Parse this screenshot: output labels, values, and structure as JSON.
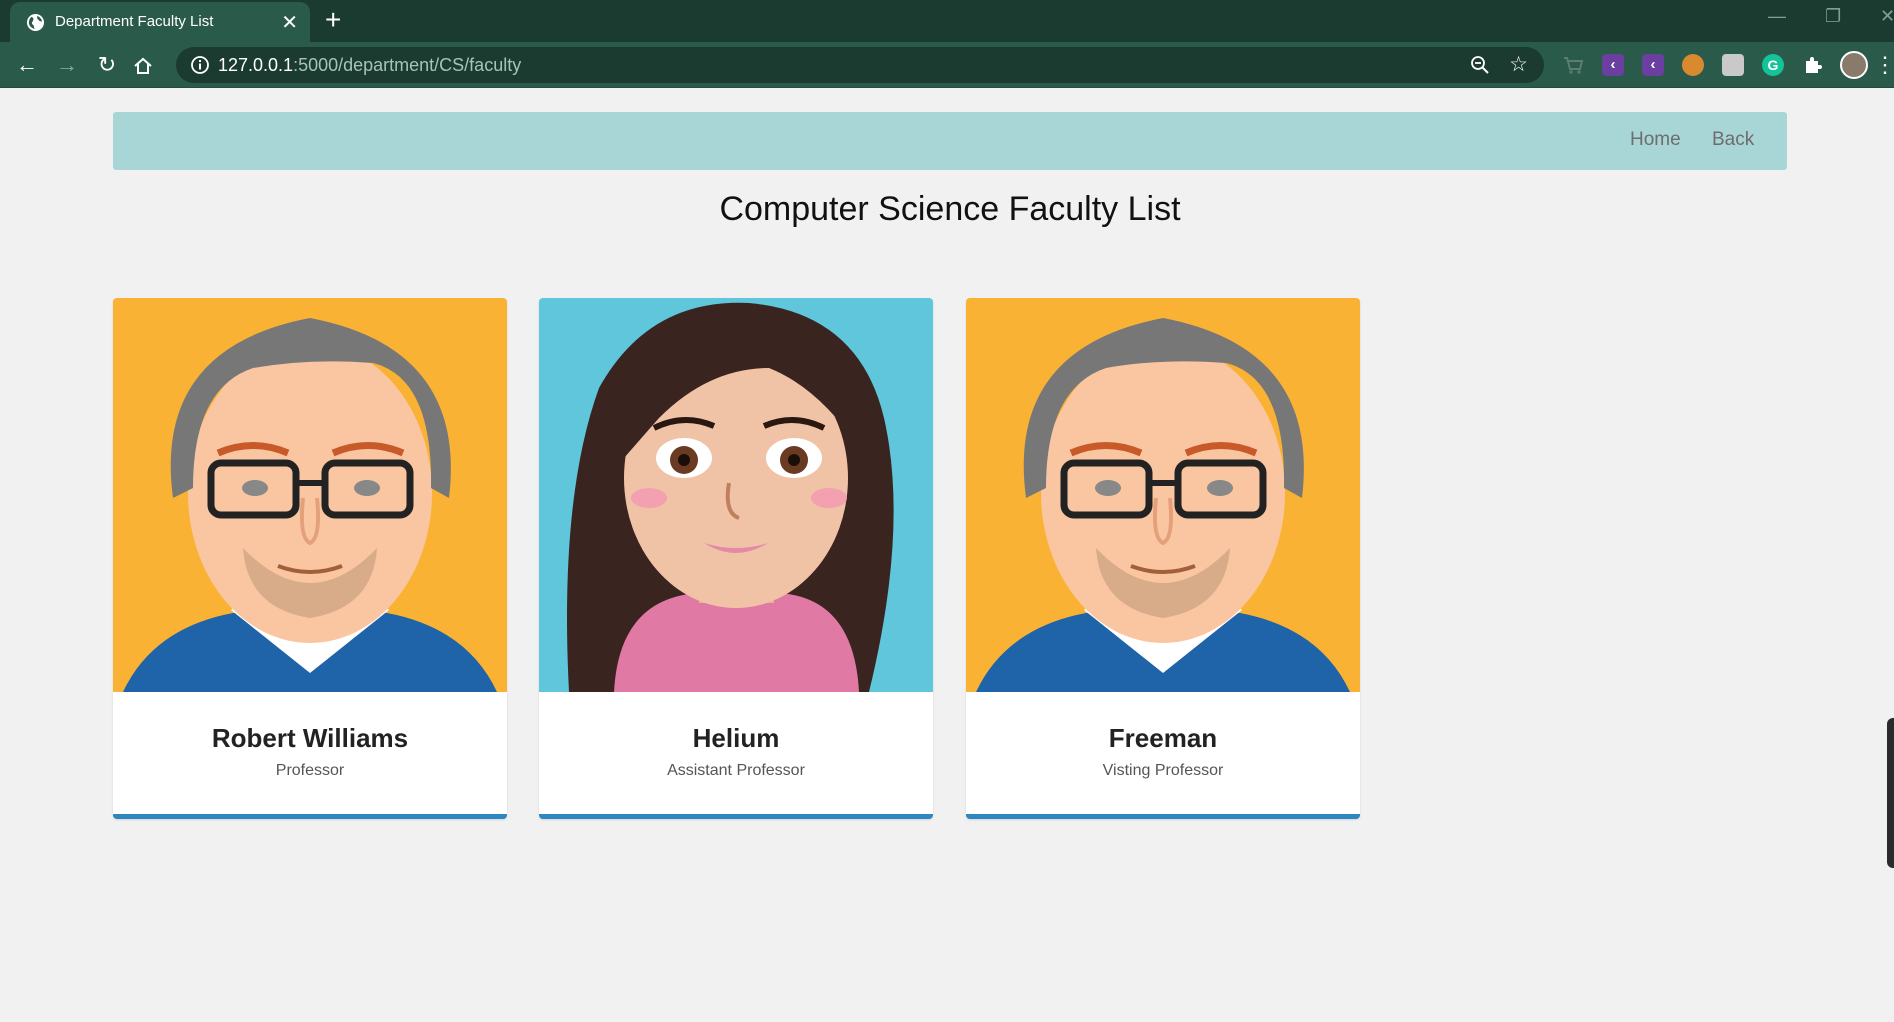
{
  "browser": {
    "tab_title": "Department Faculty List",
    "url_host": "127.0.0.1",
    "url_rest": ":5000/department/CS/faculty"
  },
  "nav": {
    "home": "Home",
    "back": "Back"
  },
  "page": {
    "heading": "Computer Science Faculty List"
  },
  "faculty": [
    {
      "name": "Robert Williams",
      "role": "Professor",
      "avatar": "male-avatar"
    },
    {
      "name": "Helium",
      "role": "Assistant Professor",
      "avatar": "female-avatar"
    },
    {
      "name": "Freeman",
      "role": "Visting Professor",
      "avatar": "male-avatar"
    }
  ],
  "colors": {
    "navbar": "#a8d6d6",
    "card_accent": "#2e86c1",
    "male_bg": "#f9b233",
    "female_bg": "#5fc6dc",
    "chrome_dark": "#1b3b30",
    "chrome_tab": "#2a5a4a"
  }
}
